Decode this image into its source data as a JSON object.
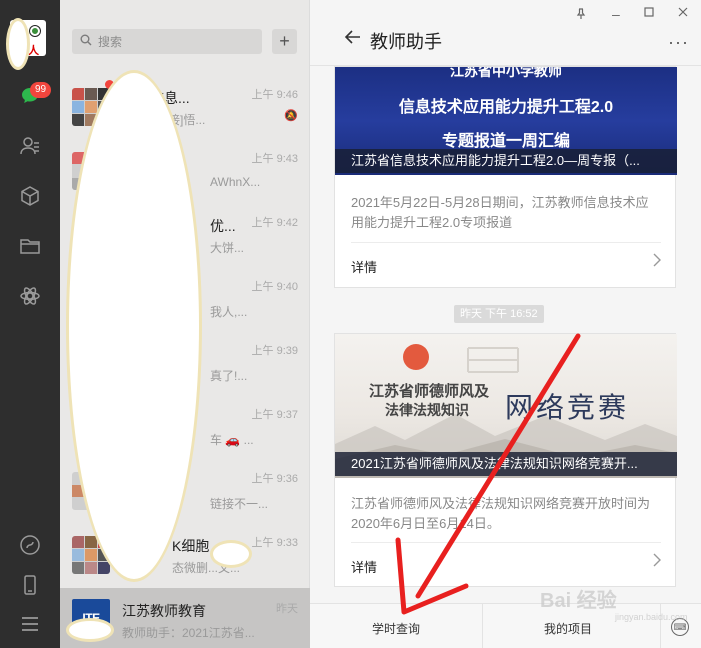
{
  "rail": {
    "avatar_text": "人",
    "badge": "99"
  },
  "list": {
    "search_placeholder": "搜索",
    "plus": "+",
    "chats": [
      {
        "name": "天，信息...",
        "preview": "上午: [链接]悟...",
        "time": "上午 9:46"
      },
      {
        "name": "",
        "preview": "AWhnX...",
        "time": "上午 9:43"
      },
      {
        "name": "优...",
        "preview": "大饼...",
        "time": "上午 9:42"
      },
      {
        "name": "",
        "preview": "我人,...",
        "time": "上午 9:40"
      },
      {
        "name": "",
        "preview": "真了!...",
        "time": "上午 9:39"
      },
      {
        "name": "",
        "preview": "车 🚗 ...",
        "time": "上午 9:37"
      },
      {
        "name": "",
        "preview": "链接不一...",
        "time": "上午 9:36"
      },
      {
        "name": "K细胞",
        "preview": "态微删...文...",
        "time": "上午 9:33"
      },
      {
        "name": "江苏教师教育",
        "preview": "教师助手：2021江苏省...",
        "time": "昨天",
        "logo": "ITE"
      }
    ]
  },
  "conv": {
    "title": "教师助手",
    "card1": {
      "banner_l1": "江苏省中小学教师",
      "banner_l2": "信息技术应用能力提升工程2.0",
      "banner_l3": "专题报道一周汇编",
      "caption": "江苏省信息技术应用能力提升工程2.0—周专报（...",
      "desc": "2021年5月22日-5月28日期间，江苏教师信息技术应用能力提升工程2.0专项报道",
      "detail": "详情"
    },
    "timestamp": "昨天 下午 16:52",
    "card2": {
      "banner_t1": "江苏省师德师风及",
      "banner_t2": "法律法规知识",
      "banner_t3": "网络竞赛",
      "caption": "2021江苏省师德师风及法律法规知识网络竞赛开...",
      "desc": "江苏省师德师风及法律法规知识网络竞赛开放时间为2020年6月日至6月14日。",
      "detail": "详情"
    },
    "menu": {
      "item1": "学时查询",
      "item2": "我的项目"
    }
  },
  "watermark": {
    "main": "Bai 经验",
    "sub": "jingyan.baidu.com"
  },
  "colors": {
    "rail": "#2e2e2e",
    "badge": "#f2453d",
    "arrow": "#e8201f",
    "banner1": "#263d9e"
  }
}
